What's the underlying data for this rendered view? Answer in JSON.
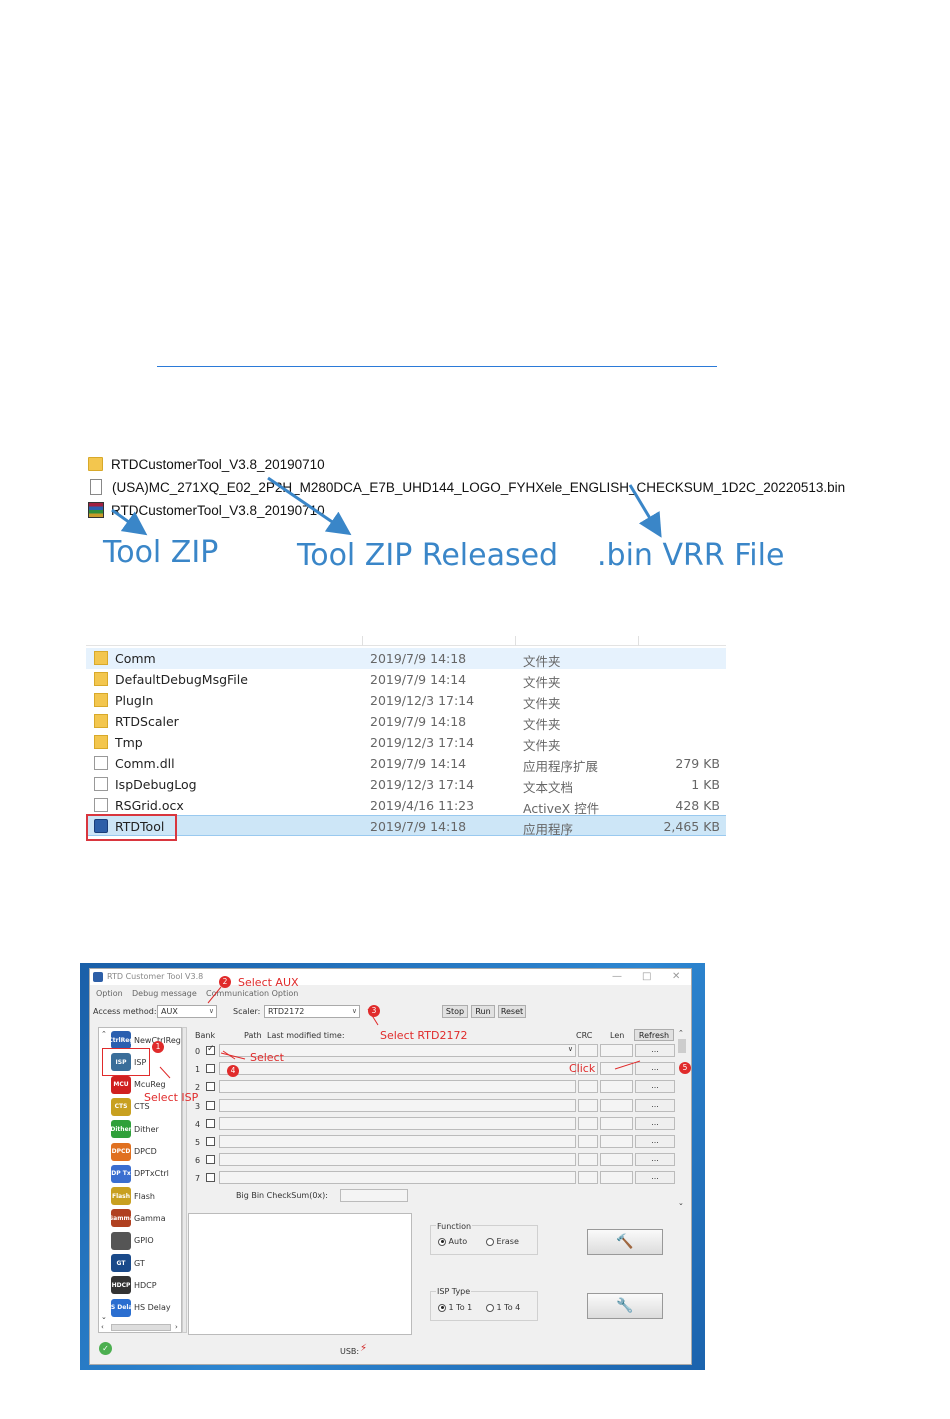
{
  "files1": {
    "rows": [
      {
        "icon": "folder-icon",
        "name": "RTDCustomerTool_V3.8_20190710"
      },
      {
        "icon": "file-icon",
        "name": "(USA)MC_271XQ_E02_2P2H_M280DCA_E7B_UHD144_LOGO_FYHXele_ENGLISH_CHECKSUM_1D2C_20220513.bin"
      },
      {
        "icon": "rar-archive-icon",
        "name": "RTDCustomerTool_V3.8_20190710"
      }
    ],
    "annotations": [
      "Tool ZIP",
      "Tool ZIP Released",
      ".bin VRR File"
    ],
    "arrow_color": "#3a86c8"
  },
  "explorer": {
    "rows": [
      {
        "icon": "folder-icon",
        "name": "Comm",
        "date": "2019/7/9 14:18",
        "type": "文件夹",
        "size": ""
      },
      {
        "icon": "folder-icon",
        "name": "DefaultDebugMsgFile",
        "date": "2019/7/9 14:14",
        "type": "文件夹",
        "size": ""
      },
      {
        "icon": "folder-icon",
        "name": "PlugIn",
        "date": "2019/12/3 17:14",
        "type": "文件夹",
        "size": ""
      },
      {
        "icon": "folder-icon",
        "name": "RTDScaler",
        "date": "2019/7/9 14:18",
        "type": "文件夹",
        "size": ""
      },
      {
        "icon": "folder-icon",
        "name": "Tmp",
        "date": "2019/12/3 17:14",
        "type": "文件夹",
        "size": ""
      },
      {
        "icon": "dll-file-icon",
        "name": "Comm.dll",
        "date": "2019/7/9 14:14",
        "type": "应用程序扩展",
        "size": "279 KB"
      },
      {
        "icon": "text-file-icon",
        "name": "IspDebugLog",
        "date": "2019/12/3 17:14",
        "type": "文本文档",
        "size": "1 KB"
      },
      {
        "icon": "ocx-file-icon",
        "name": "RSGrid.ocx",
        "date": "2019/4/16 11:23",
        "type": "ActiveX 控件",
        "size": "428 KB"
      },
      {
        "icon": "app-icon",
        "name": "RTDTool",
        "date": "2019/7/9 14:18",
        "type": "应用程序",
        "size": "2,465 KB"
      }
    ],
    "highlight_color": "#d9363e"
  },
  "tool": {
    "title": "RTD Customer Tool V3.8",
    "menu": [
      "Option",
      "Debug message",
      "Communication Option"
    ],
    "access_label": "Access method:",
    "access_value": "AUX",
    "scaler_label": "Scaler:",
    "scaler_value": "RTD2172",
    "buttons": {
      "stop": "Stop",
      "run": "Run",
      "reset": "Reset",
      "refresh": "Refresh",
      "browse": "..."
    },
    "headers": {
      "bank": "Bank",
      "path": "Path",
      "modified": "Last modified time:",
      "crc": "CRC",
      "len": "Len"
    },
    "banks": [
      "0",
      "1",
      "2",
      "3",
      "4",
      "5",
      "6",
      "7"
    ],
    "bank0_checked": true,
    "checksum_label": "Big Bin CheckSum(0x):",
    "left_items": [
      {
        "label": "NewCtrlReg",
        "icon": "ctrlreg-icon",
        "badge": "CtrlReg",
        "color": "#2a5fb0"
      },
      {
        "label": "ISP",
        "icon": "isp-icon",
        "badge": "ISP",
        "color": "#3a6e9a"
      },
      {
        "label": "McuReg",
        "icon": "mcu-icon",
        "badge": "MCU",
        "color": "#d02020"
      },
      {
        "label": "CTS",
        "icon": "cts-icon",
        "badge": "CTS",
        "color": "#c8a020"
      },
      {
        "label": "Dither",
        "icon": "dither-icon",
        "badge": "Dither",
        "color": "#2fa03a"
      },
      {
        "label": "DPCD",
        "icon": "dpcd-icon",
        "badge": "DPCD",
        "color": "#e07020"
      },
      {
        "label": "DPTxCtrl",
        "icon": "dptx-icon",
        "badge": "DP Tx",
        "color": "#3a6ed0"
      },
      {
        "label": "Flash",
        "icon": "flash-icon",
        "badge": "Flash",
        "color": "#c8a020"
      },
      {
        "label": "Gamma",
        "icon": "gamma-icon",
        "badge": "Gamma",
        "color": "#b04020"
      },
      {
        "label": "GPIO",
        "icon": "gpio-icon",
        "badge": "",
        "color": "#555555"
      },
      {
        "label": "GT",
        "icon": "gt-icon",
        "badge": "GT",
        "color": "#1a4a8a"
      },
      {
        "label": "HDCP",
        "icon": "hdcp-icon",
        "badge": "HDCP",
        "color": "#333333"
      },
      {
        "label": "HS Delay",
        "icon": "hsdelay-icon",
        "badge": "HS Delay",
        "color": "#2a6ed0"
      }
    ],
    "function_label": "Function",
    "function_options": [
      "Auto",
      "Erase"
    ],
    "function_selected": "Auto",
    "isptype_label": "ISP Type",
    "isptype_options": [
      "1 To 1",
      "1 To 4"
    ],
    "isptype_selected": "1 To 1",
    "usb_label": "USB:",
    "callouts": {
      "n1": "1",
      "n2": "2",
      "n3": "3",
      "n4": "4",
      "n5": "5",
      "select_aux": "Select AUX",
      "select_rtd": "Select RTD2172",
      "select": "Select",
      "select_isp": "Select ISP",
      "click": "Click"
    },
    "callout_color": "#e02b2b"
  }
}
